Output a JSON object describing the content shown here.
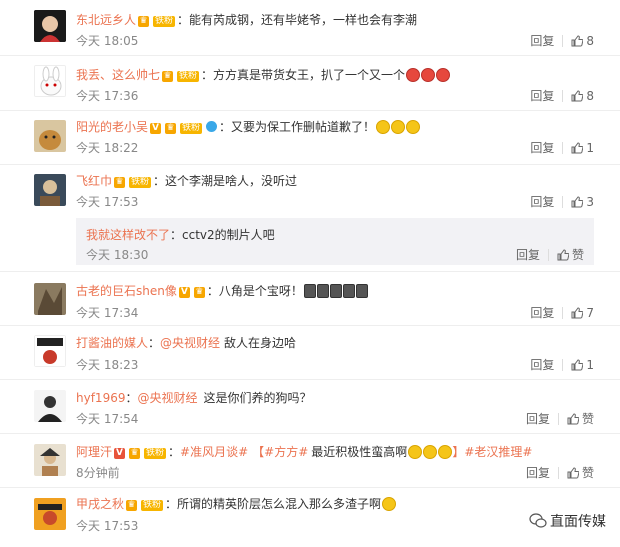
{
  "comments": [
    {
      "user": "东北远乡人",
      "badge": "铁粉",
      "text": "：能有芮成钢，还有毕姥爷，一样也会有李潮",
      "time": "今天 18:05",
      "reply": "回复",
      "likes": "8",
      "emoji": []
    },
    {
      "user": "我丢、这么帅七",
      "badge": "铁粉",
      "text": "：方方真是带货女王，扒了一个又一个",
      "time": "今天 17:36",
      "reply": "回复",
      "likes": "8",
      "emoji": [
        "red",
        "red",
        "red"
      ]
    },
    {
      "user": "阳光的老小吴",
      "badge": "铁粉",
      "text": "：又要为保工作删帖道歉了！",
      "time": "今天 18:22",
      "reply": "回复",
      "likes": "1",
      "emoji": [
        "y",
        "y",
        "y"
      ]
    },
    {
      "user": "飞红巾",
      "badge": "铁粉",
      "text": "：这个李潮是啥人，没听过",
      "time": "今天 17:53",
      "reply": "回复",
      "likes": "3",
      "emoji": []
    },
    {
      "user": "古老的巨石shen像",
      "badge": "铁粉",
      "text": "：八角是个宝呀！",
      "time": "今天 17:34",
      "reply": "回复",
      "likes": "7",
      "emoji": [
        "dark",
        "dark",
        "dark",
        "dark",
        "dark"
      ]
    },
    {
      "user": "打酱油的媒人",
      "badge": "",
      "mention": "@央视财经",
      "text": "敌人在身边哈",
      "time": "今天 18:23",
      "reply": "回复",
      "likes": "1",
      "emoji": []
    },
    {
      "user": "hyf1969",
      "badge": "",
      "mention": "@央视财经",
      "text": "这是你们养的狗吗？",
      "time": "今天 17:54",
      "reply": "回复",
      "likes": "赞",
      "emoji": []
    },
    {
      "user": "阿理汗",
      "badge": "铁粉",
      "tag1": "#准风月谈#",
      "tag2": "【#方方#",
      "text": "最近积极性蛮高啊",
      "tag3": "】#老汉推理#",
      "time": "8分钟前",
      "reply": "回复",
      "likes": "赞",
      "emoji": [
        "y",
        "y",
        "y"
      ]
    },
    {
      "user": "甲戌之秋",
      "badge": "铁粉",
      "text": "：所谓的精英阶层怎么混入那么多渣子啊",
      "time": "今天 17:53",
      "reply": "",
      "likes": "",
      "emoji": [
        "y"
      ]
    }
  ],
  "nested_reply": {
    "user": "我就这样改不了",
    "text": "：cctv2的制片人吧",
    "time": "今天 18:30",
    "reply": "回复",
    "likes": "赞"
  },
  "watermark": "直面传媒",
  "colors": {
    "username": "#eb7350",
    "badge": "#f7b500",
    "reply_bg": "#f2f2f5"
  }
}
